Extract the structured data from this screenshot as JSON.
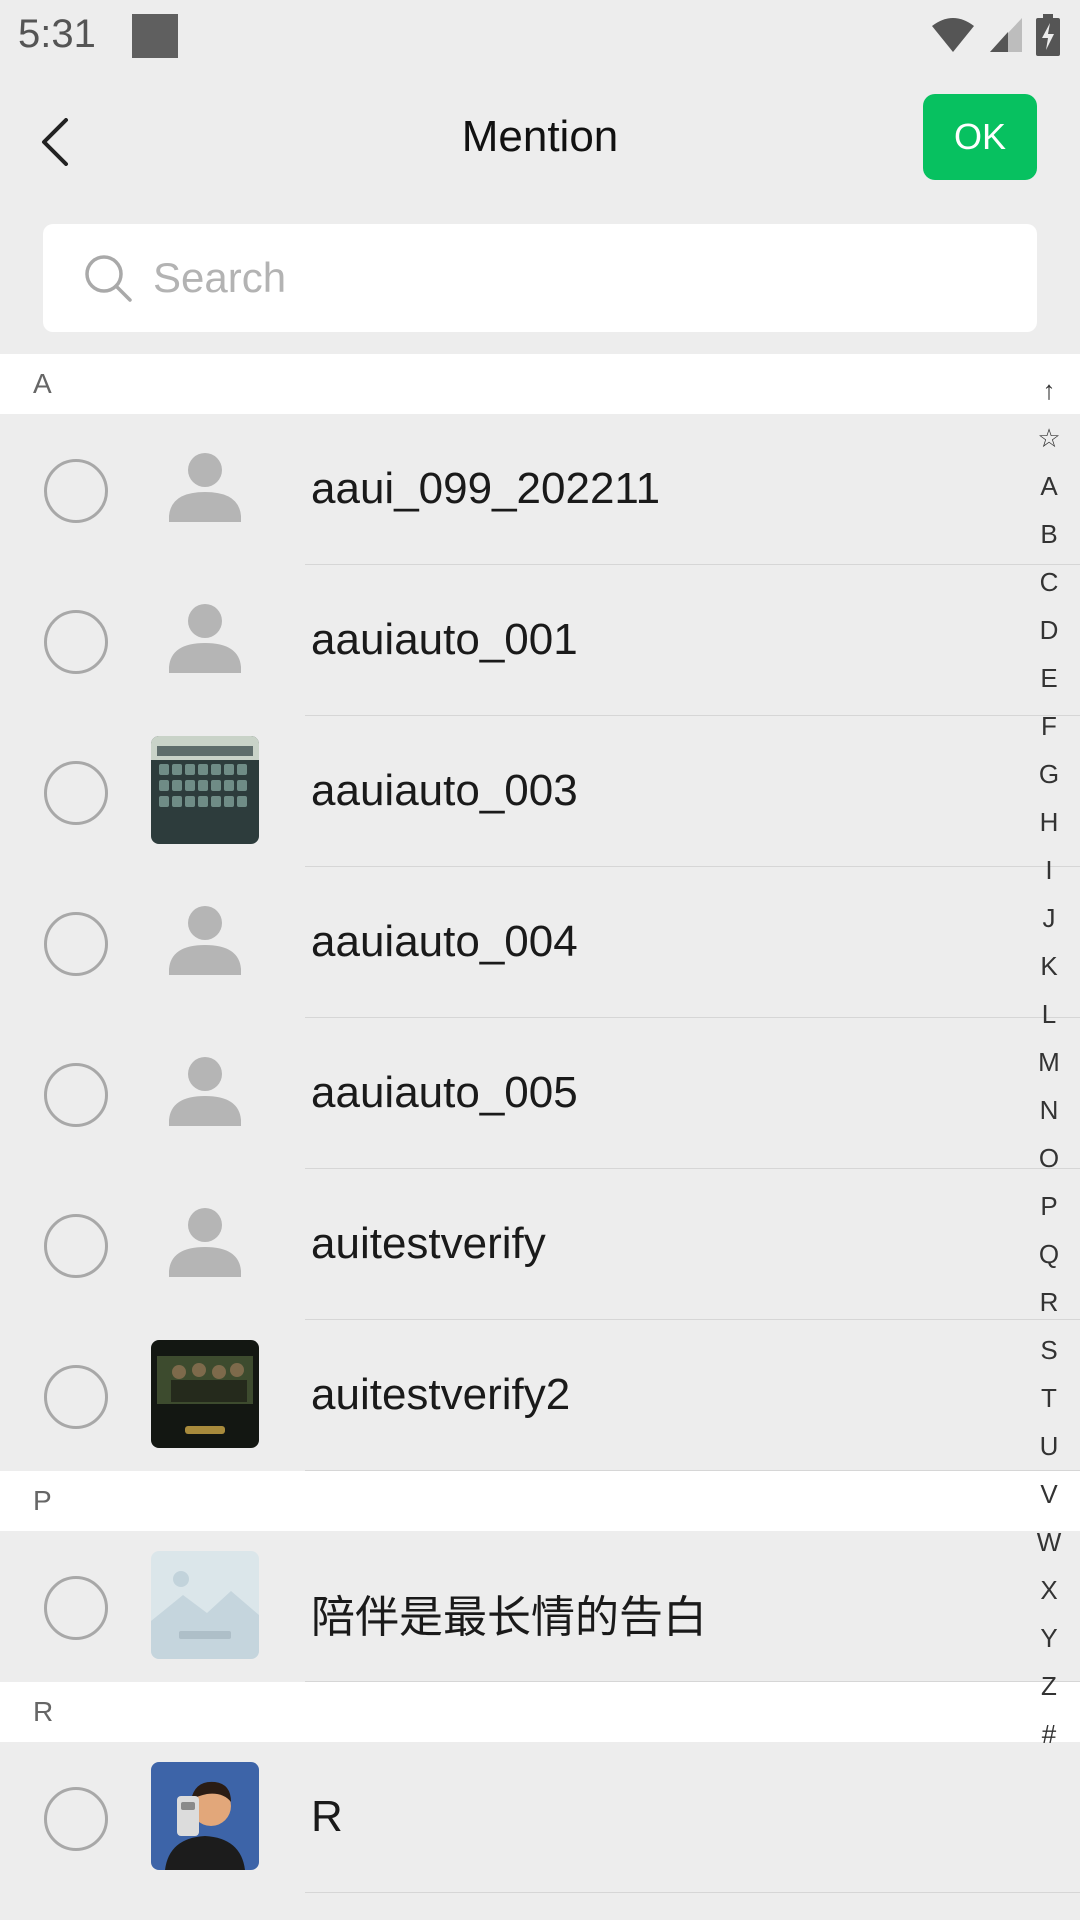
{
  "status_bar": {
    "time": "5:31"
  },
  "header": {
    "title": "Mention",
    "ok_label": "OK"
  },
  "search": {
    "placeholder": "Search"
  },
  "sections": [
    {
      "letter": "A",
      "contacts": [
        {
          "name": "aaui_099_202211",
          "avatar": "default-avatar"
        },
        {
          "name": "aauiauto_001",
          "avatar": "default-avatar"
        },
        {
          "name": "aauiauto_003",
          "avatar": "keyboard-photo"
        },
        {
          "name": "aauiauto_004",
          "avatar": "default-avatar"
        },
        {
          "name": "aauiauto_005",
          "avatar": "default-avatar"
        },
        {
          "name": "auitestverify",
          "avatar": "default-avatar"
        },
        {
          "name": "auitestverify2",
          "avatar": "group-photo"
        }
      ]
    },
    {
      "letter": "P",
      "contacts": [
        {
          "name": "陪伴是最长情的告白",
          "avatar": "image-unavailable"
        }
      ]
    },
    {
      "letter": "R",
      "contacts": [
        {
          "name": "R",
          "avatar": "cartoon-selfie"
        }
      ]
    }
  ],
  "index_bar": [
    "↑",
    "☆",
    "A",
    "B",
    "C",
    "D",
    "E",
    "F",
    "G",
    "H",
    "I",
    "J",
    "K",
    "L",
    "M",
    "N",
    "O",
    "P",
    "Q",
    "R",
    "S",
    "T",
    "U",
    "V",
    "W",
    "X",
    "Y",
    "Z",
    "#"
  ],
  "colors": {
    "accent": "#07c160",
    "background": "#ededed"
  }
}
